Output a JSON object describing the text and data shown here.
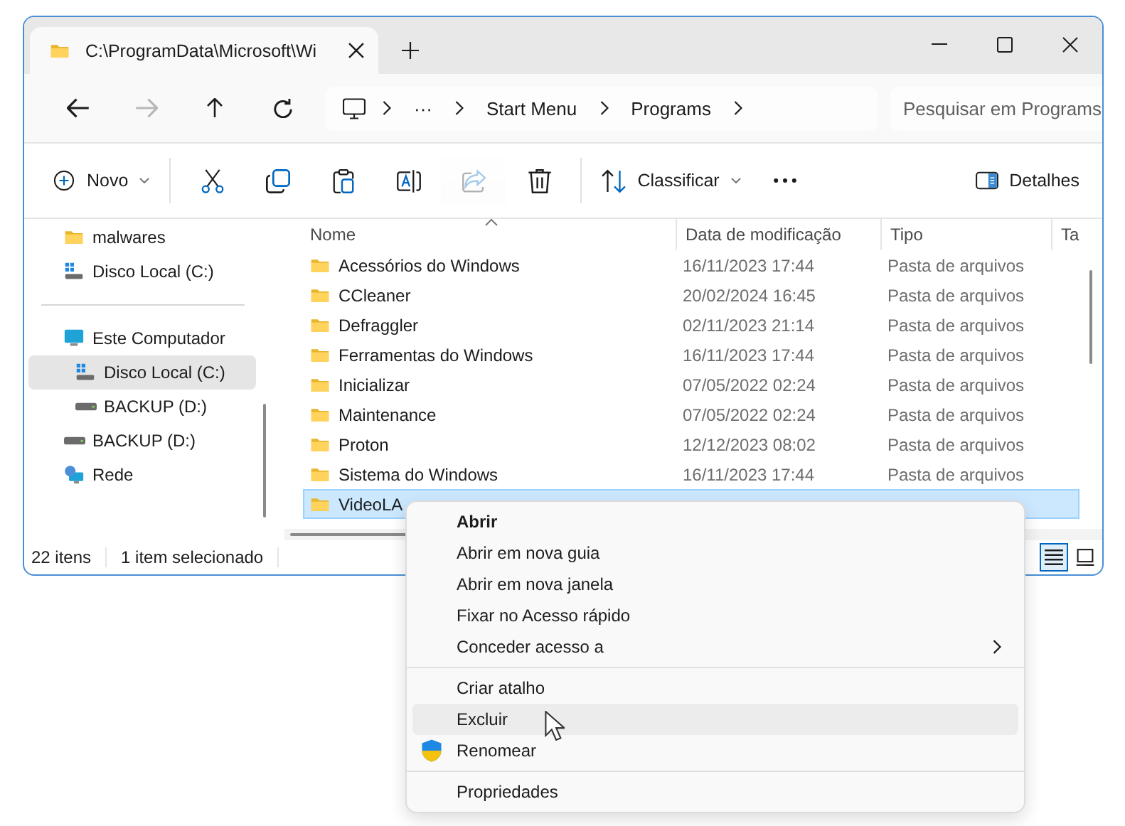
{
  "window": {
    "tabs": [
      {
        "title": "C:\\ProgramData\\Microsoft\\Wi",
        "selected": true
      }
    ]
  },
  "nav": {
    "buttons": [
      {
        "kind": "back",
        "disabled": false
      },
      {
        "kind": "forward",
        "disabled": true
      },
      {
        "kind": "up",
        "disabled": false
      },
      {
        "kind": "refresh",
        "disabled": false
      }
    ],
    "address": [
      "···",
      "Start Menu",
      "Programs"
    ],
    "search": {
      "placeholder": "Pesquisar em Programs"
    }
  },
  "toolbar": [
    {
      "kind": "new",
      "label": "Novo",
      "disabled": false
    },
    {
      "kind": "separator"
    },
    {
      "kind": "cut",
      "disabled": false
    },
    {
      "kind": "copy",
      "disabled": false
    },
    {
      "kind": "paste",
      "disabled": false
    },
    {
      "kind": "rename",
      "disabled": false
    },
    {
      "kind": "share",
      "disabled": true
    },
    {
      "kind": "delete",
      "disabled": false
    },
    {
      "kind": "separator"
    },
    {
      "kind": "sort",
      "label": "Classificar",
      "disabled": false
    },
    {
      "kind": "more",
      "disabled": false
    },
    {
      "kind": "spacer"
    },
    {
      "kind": "details",
      "label": "Detalhes",
      "disabled": false
    }
  ],
  "sidebar": {
    "groups": [
      [
        {
          "label": "malwares",
          "kind": "folder",
          "selected": false
        },
        {
          "label": "Disco Local (C:)",
          "kind": "system",
          "selected": false
        }
      ],
      [
        {
          "label": "Este Computador",
          "kind": "computer",
          "selected": false,
          "children": [
            {
              "label": "Disco Local (C:)",
              "kind": "system",
              "selected": true
            },
            {
              "label": "BACKUP (D:)",
              "kind": "drive",
              "selected": false
            }
          ]
        },
        {
          "label": "BACKUP (D:)",
          "kind": "drive",
          "selected": false
        },
        {
          "label": "Rede",
          "kind": "network",
          "selected": false
        }
      ]
    ]
  },
  "table": {
    "columns": [
      {
        "label": "Nome",
        "sorted": true
      },
      {
        "label": "Data de modificação",
        "sorted": false
      },
      {
        "label": "Tipo",
        "sorted": false
      },
      {
        "label": "Ta",
        "sorted": false
      }
    ],
    "rows": [
      {
        "name": "Acessórios do Windows",
        "date": "16/11/2023 17:44",
        "type": "Pasta de arquivos",
        "selected": false
      },
      {
        "name": "CCleaner",
        "date": "20/02/2024 16:45",
        "type": "Pasta de arquivos",
        "selected": false
      },
      {
        "name": "Defraggler",
        "date": "02/11/2023 21:14",
        "type": "Pasta de arquivos",
        "selected": false
      },
      {
        "name": "Ferramentas do Windows",
        "date": "16/11/2023 17:44",
        "type": "Pasta de arquivos",
        "selected": false
      },
      {
        "name": "Inicializar",
        "date": "07/05/2022 02:24",
        "type": "Pasta de arquivos",
        "selected": false
      },
      {
        "name": "Maintenance",
        "date": "07/05/2022 02:24",
        "type": "Pasta de arquivos",
        "selected": false
      },
      {
        "name": "Proton",
        "date": "12/12/2023 08:02",
        "type": "Pasta de arquivos",
        "selected": false
      },
      {
        "name": "Sistema do Windows",
        "date": "16/11/2023 17:44",
        "type": "Pasta de arquivos",
        "selected": false
      },
      {
        "name": "VideoLA",
        "selected": true
      }
    ]
  },
  "status_bar": {
    "count": "22 itens",
    "selection": "1 item selecionado",
    "views": [
      {
        "kind": "details",
        "selected": true
      },
      {
        "kind": "tiles",
        "selected": false
      }
    ]
  },
  "context_menu": {
    "items": [
      {
        "kind": "item",
        "label": "Abrir",
        "bold": true,
        "hovered": false
      },
      {
        "kind": "item",
        "label": "Abrir em nova guia",
        "bold": false,
        "hovered": false
      },
      {
        "kind": "item",
        "label": "Abrir em nova janela",
        "bold": false,
        "hovered": false
      },
      {
        "kind": "item",
        "label": "Fixar no Acesso rápido",
        "bold": false,
        "hovered": false
      },
      {
        "kind": "item",
        "label": "Conceder acesso a",
        "bold": false,
        "hovered": false,
        "submenu": true
      },
      {
        "kind": "separator"
      },
      {
        "kind": "item",
        "label": "Criar atalho",
        "bold": false,
        "hovered": false
      },
      {
        "kind": "item",
        "label": "Excluir",
        "bold": false,
        "hovered": true
      },
      {
        "kind": "shielded",
        "label": "Renomear",
        "bold": false,
        "hovered": false
      },
      {
        "kind": "separator"
      },
      {
        "kind": "item",
        "label": "Propriedades",
        "bold": false,
        "hovered": false
      }
    ]
  }
}
